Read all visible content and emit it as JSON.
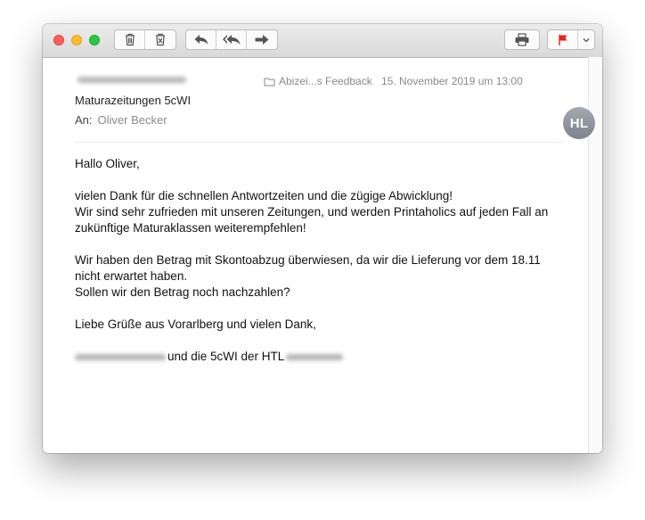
{
  "window": {
    "toolbar": {
      "delete_icon": "trash-icon",
      "junk_icon": "junk-icon",
      "reply_icon": "reply-icon",
      "reply_all_icon": "reply-all-icon",
      "forward_icon": "forward-icon",
      "print_icon": "printer-icon",
      "flag_icon": "flag-icon",
      "flag_color": "#e8231e"
    }
  },
  "message": {
    "subject": "Maturazeitungen 5cWI",
    "to_label": "An:",
    "to_name": "Oliver Becker",
    "folder": "Abizei...s Feedback",
    "date": "15. November 2019 um 13:00",
    "avatar_initials": "HL",
    "body": {
      "greeting": "Hallo Oliver,",
      "p1_l1": "vielen Dank für die schnellen Antwortzeiten und die zügige Abwicklung!",
      "p1_l2": "Wir sind sehr zufrieden mit unseren Zeitungen, und werden Printaholics auf jeden Fall an",
      "p1_l3": "zukünftige Maturaklassen weiterempfehlen!",
      "p2_l1": "Wir haben den Betrag mit Skontoabzug überwiesen, da wir die Lieferung vor dem 18.11",
      "p2_l2": "nicht erwartet haben.",
      "p2_l3": "Sollen wir den Betrag noch nachzahlen?",
      "closing": "Liebe Grüße aus Vorarlberg und vielen Dank,",
      "signature": "und die 5cWI der HTL"
    }
  }
}
